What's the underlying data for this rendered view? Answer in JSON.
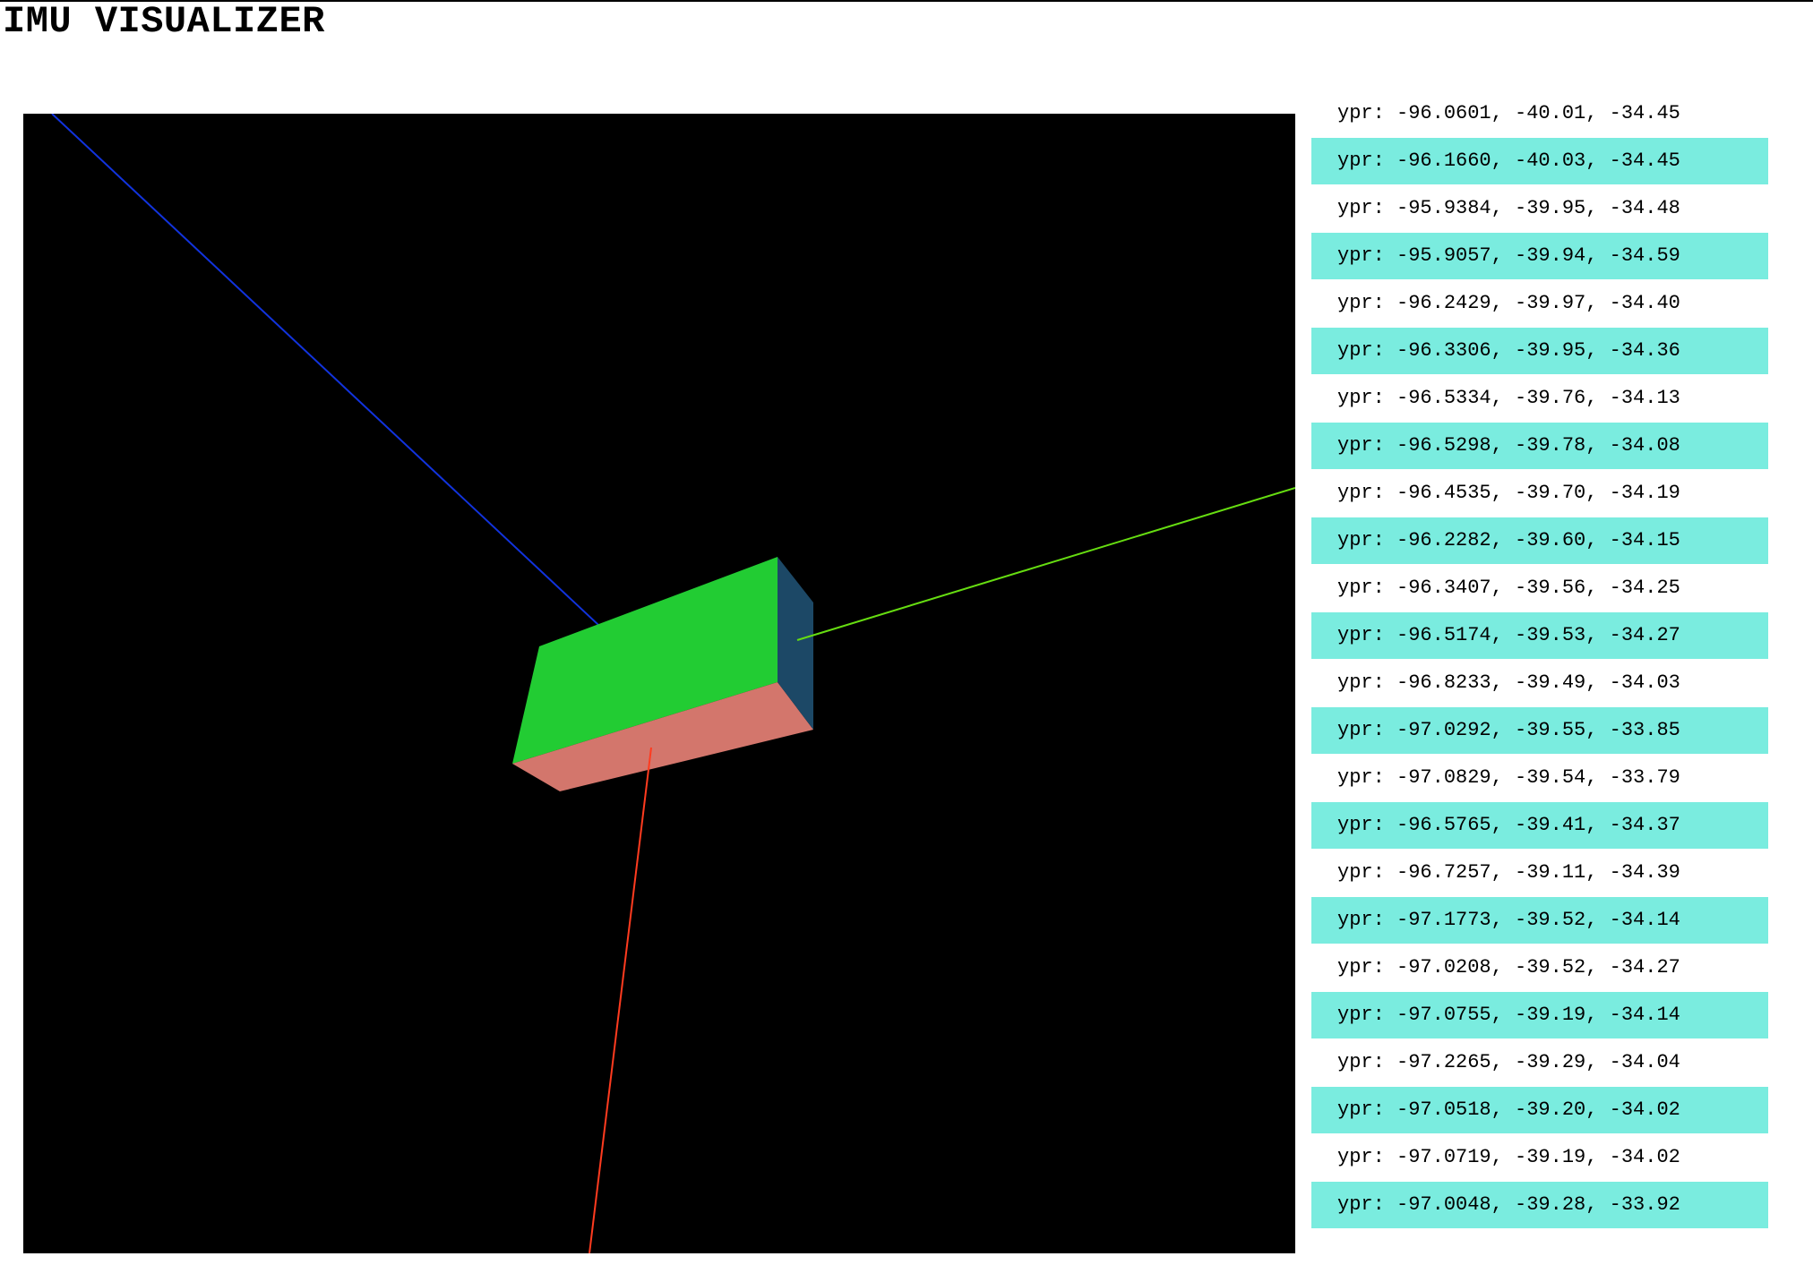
{
  "title": "IMU VISUALIZER",
  "colors": {
    "scene_background": "#000000",
    "box_top": "#22cc33",
    "box_front": "#d3766c",
    "box_side": "#1c4866",
    "axis_x": "#ff3b1f",
    "axis_y": "#66dd11",
    "axis_z": "#1133dd",
    "row_highlight": "#7aecdf"
  },
  "orientation": {
    "yaw": -96.0601,
    "pitch": -40.01,
    "roll": -34.45
  },
  "log": {
    "entries": [
      "ypr: -96.0601, -40.01, -34.45",
      "ypr: -96.1660, -40.03, -34.45",
      "ypr: -95.9384, -39.95, -34.48",
      "ypr: -95.9057, -39.94, -34.59",
      "ypr: -96.2429, -39.97, -34.40",
      "ypr: -96.3306, -39.95, -34.36",
      "ypr: -96.5334, -39.76, -34.13",
      "ypr: -96.5298, -39.78, -34.08",
      "ypr: -96.4535, -39.70, -34.19",
      "ypr: -96.2282, -39.60, -34.15",
      "ypr: -96.3407, -39.56, -34.25",
      "ypr: -96.5174, -39.53, -34.27",
      "ypr: -96.8233, -39.49, -34.03",
      "ypr: -97.0292, -39.55, -33.85",
      "ypr: -97.0829, -39.54, -33.79",
      "ypr: -96.5765, -39.41, -34.37",
      "ypr: -96.7257, -39.11, -34.39",
      "ypr: -97.1773, -39.52, -34.14",
      "ypr: -97.0208, -39.52, -34.27",
      "ypr: -97.0755, -39.19, -34.14",
      "ypr: -97.2265, -39.29, -34.04",
      "ypr: -97.0518, -39.20, -34.02",
      "ypr: -97.0719, -39.19, -34.02",
      "ypr: -97.0048, -39.28, -33.92"
    ]
  }
}
